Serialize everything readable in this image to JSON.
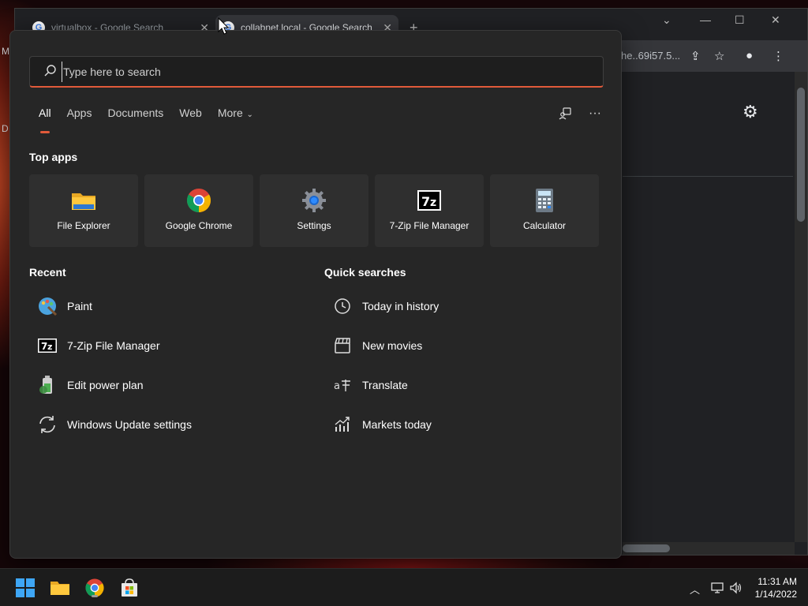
{
  "browser": {
    "tabs": [
      {
        "title": "virtualbox - Google Search"
      },
      {
        "title": "collabnet.local - Google Search"
      }
    ],
    "new_tab_label": "+",
    "omnibox_fragment": "he..69i57.5...",
    "left_fragments": [
      "M",
      "D"
    ]
  },
  "start_menu": {
    "search": {
      "placeholder": "Type here to search",
      "value": ""
    },
    "filters": [
      {
        "label": "All",
        "active": true
      },
      {
        "label": "Apps",
        "active": false
      },
      {
        "label": "Documents",
        "active": false
      },
      {
        "label": "Web",
        "active": false
      },
      {
        "label": "More",
        "active": false
      }
    ],
    "top_apps_title": "Top apps",
    "top_apps": [
      {
        "label": "File Explorer",
        "icon": "folder-icon"
      },
      {
        "label": "Google Chrome",
        "icon": "chrome-icon"
      },
      {
        "label": "Settings",
        "icon": "settings-gear-icon"
      },
      {
        "label": "7-Zip File Manager",
        "icon": "7zip-icon"
      },
      {
        "label": "Calculator",
        "icon": "calculator-icon"
      }
    ],
    "recent_title": "Recent",
    "recent": [
      {
        "label": "Paint",
        "icon": "paint-icon"
      },
      {
        "label": "7-Zip File Manager",
        "icon": "7zip-icon"
      },
      {
        "label": "Edit power plan",
        "icon": "battery-icon"
      },
      {
        "label": "Windows Update settings",
        "icon": "sync-icon"
      }
    ],
    "quick_searches_title": "Quick searches",
    "quick_searches": [
      {
        "label": "Today in history",
        "icon": "clock-icon"
      },
      {
        "label": "New movies",
        "icon": "clapperboard-icon"
      },
      {
        "label": "Translate",
        "icon": "translate-icon"
      },
      {
        "label": "Markets today",
        "icon": "chart-icon"
      }
    ]
  },
  "taskbar": {
    "clock_time": "11:31 AM",
    "clock_date": "1/14/2022"
  },
  "colors": {
    "accent": "#e15a3a",
    "panel": "#262626",
    "tile": "#2f2f2f"
  }
}
